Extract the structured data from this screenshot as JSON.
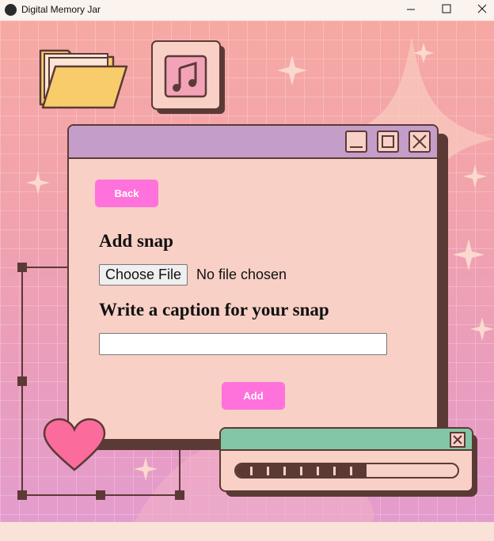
{
  "app": {
    "title": "Digital Memory Jar"
  },
  "form": {
    "back_label": "Back",
    "heading": "Add snap",
    "file_button_label": "Choose File",
    "file_status": "No file chosen",
    "caption_label": "Write a caption for your snap",
    "caption_value": "",
    "add_label": "Add"
  },
  "progress": {
    "fraction": 0.59
  },
  "colors": {
    "accent_button": "#ff72dc",
    "window_title": "#c49dc9",
    "window_body": "#f8d0c5",
    "outline": "#5b3a36",
    "progress_title": "#83c6a6"
  },
  "icons": [
    "folder-icon",
    "music-note-icon",
    "heart-icon",
    "sparkle-icon",
    "minimize-icon",
    "maximize-icon",
    "close-icon"
  ]
}
